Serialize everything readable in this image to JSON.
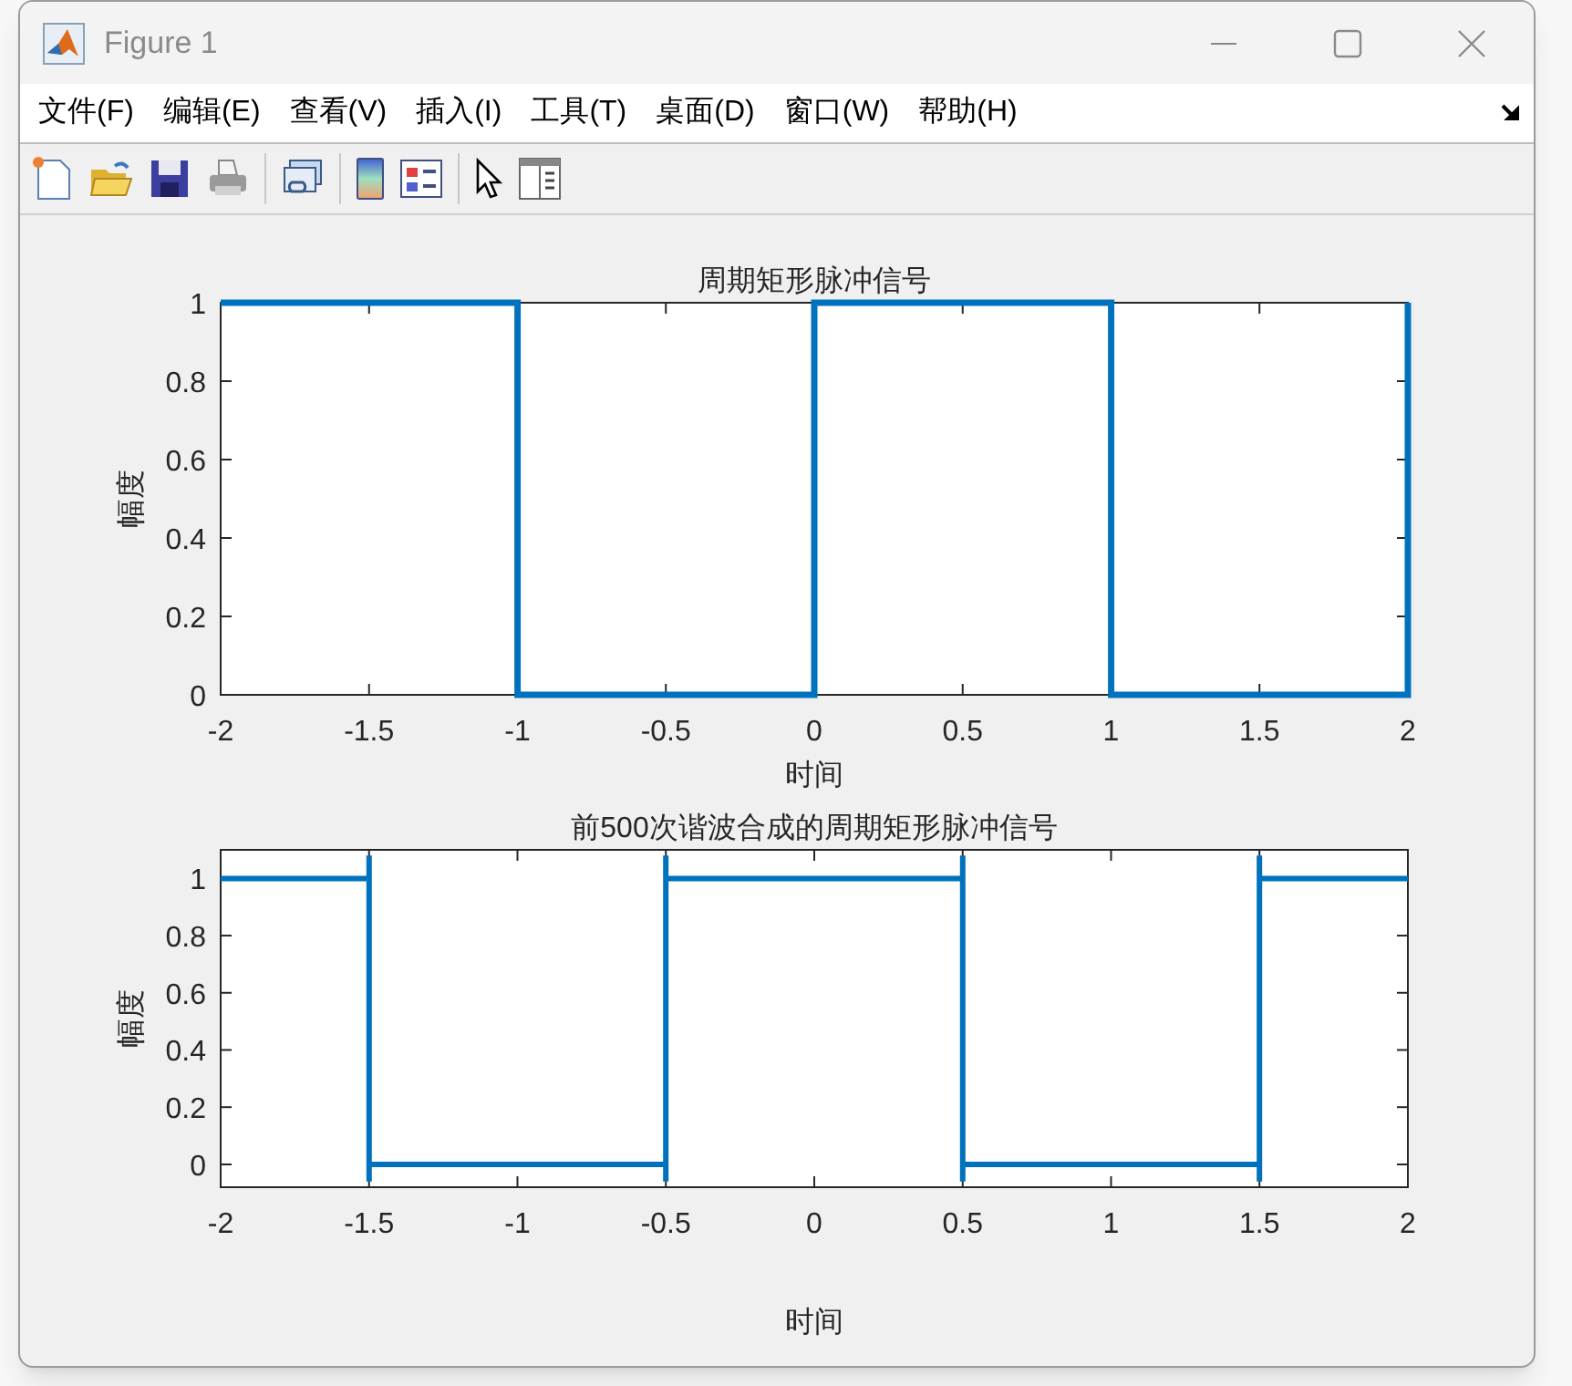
{
  "window": {
    "title": "Figure 1"
  },
  "menu": [
    {
      "label": "文件(F)"
    },
    {
      "label": "编辑(E)"
    },
    {
      "label": "查看(V)"
    },
    {
      "label": "插入(I)"
    },
    {
      "label": "工具(T)"
    },
    {
      "label": "桌面(D)"
    },
    {
      "label": "窗口(W)"
    },
    {
      "label": "帮助(H)"
    }
  ],
  "plots": [
    {
      "chart_data": {
        "type": "line",
        "title": "周期矩形脉冲信号",
        "xlabel": "时间",
        "ylabel": "幅度",
        "x": [
          -2,
          -1,
          -1,
          0,
          0,
          1,
          1,
          2,
          2
        ],
        "series": [
          {
            "color": "#0072bd",
            "values": [
              1,
              1,
              0,
              0,
              1,
              1,
              0,
              0,
              1
            ]
          }
        ],
        "xlim": [
          -2,
          2
        ],
        "ylim": [
          0,
          1
        ],
        "xticks": [
          -2,
          -1.5,
          -1,
          -0.5,
          0,
          0.5,
          1,
          1.5,
          2
        ],
        "yticks": [
          0,
          0.2,
          0.4,
          0.6,
          0.8,
          1
        ]
      }
    },
    {
      "chart_data": {
        "type": "line",
        "title": "前500次谐波合成的周期矩形脉冲信号",
        "xlabel": "时间",
        "ylabel": "幅度",
        "x": [
          -2,
          -1.5,
          -1.5,
          -1.5,
          -1.5,
          -0.5,
          -0.5,
          -0.5,
          -0.5,
          0.5,
          0.5,
          0.5,
          0.5,
          1.5,
          1.5,
          1.5,
          1.5,
          2
        ],
        "series": [
          {
            "color": "#0072bd",
            "values": [
              1,
              1,
              1.08,
              -0.06,
              0,
              0,
              -0.06,
              1.08,
              1,
              1,
              1.08,
              -0.06,
              0,
              0,
              -0.06,
              1.08,
              1,
              1
            ]
          }
        ],
        "xlim": [
          -2,
          2
        ],
        "ylim": [
          -0.08,
          1.1
        ],
        "xticks": [
          -2,
          -1.5,
          -1,
          -0.5,
          0,
          0.5,
          1,
          1.5,
          2
        ],
        "yticks": [
          0,
          0.2,
          0.4,
          0.6,
          0.8,
          1
        ]
      }
    }
  ]
}
